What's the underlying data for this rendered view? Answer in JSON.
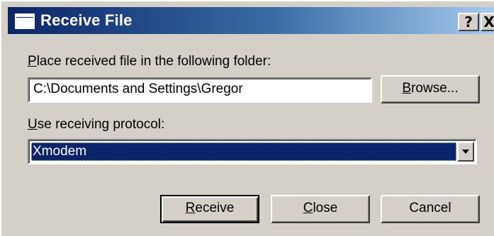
{
  "window": {
    "title": "Receive File",
    "help_glyph": "?",
    "close_glyph": "X",
    "icon": "window-icon"
  },
  "folder": {
    "label": "Place received file in the following folder:",
    "label_mnemonic": "P",
    "label_rest": "lace received file in the following folder:",
    "value": "C:\\Documents and Settings\\Gregor",
    "browse_mnemonic": "B",
    "browse_rest": "rowse..."
  },
  "protocol": {
    "label": "Use receiving protocol:",
    "label_mnemonic": "U",
    "label_rest": "se receiving protocol:",
    "selected": "Xmodem",
    "dropdown_icon": "chevron-down-icon"
  },
  "buttons": {
    "receive_mnemonic": "R",
    "receive_rest": "eceive",
    "close_mnemonic": "C",
    "close_rest": "lose",
    "cancel_label": "Cancel"
  },
  "colors": {
    "titlebar_start": "#0a246a",
    "titlebar_end": "#a6caf0",
    "face": "#d4d0c8",
    "selection": "#0a246a"
  }
}
